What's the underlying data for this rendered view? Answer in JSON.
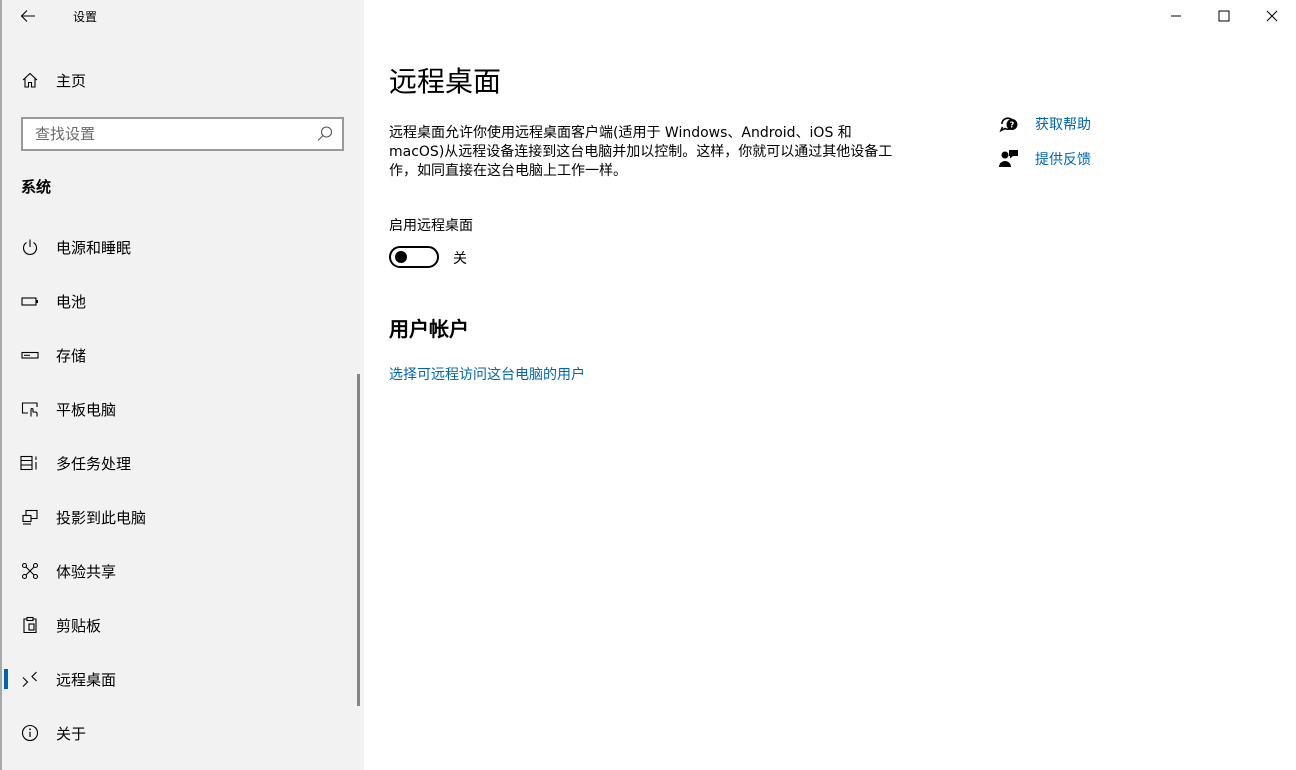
{
  "window": {
    "app_title": "设置",
    "controls": [
      "minimize-icon",
      "maximize-icon",
      "close-icon"
    ]
  },
  "sidebar": {
    "home_label": "主页",
    "search_placeholder": "查找设置",
    "section_title": "系统",
    "items": [
      {
        "label": "电源和睡眠",
        "icon": "power-icon"
      },
      {
        "label": "电池",
        "icon": "battery-icon"
      },
      {
        "label": "存储",
        "icon": "storage-icon"
      },
      {
        "label": "平板电脑",
        "icon": "tablet-icon"
      },
      {
        "label": "多任务处理",
        "icon": "multitasking-icon"
      },
      {
        "label": "投影到此电脑",
        "icon": "projecting-icon"
      },
      {
        "label": "体验共享",
        "icon": "shared-experiences-icon"
      },
      {
        "label": "剪贴板",
        "icon": "clipboard-icon"
      },
      {
        "label": "远程桌面",
        "icon": "remote-desktop-icon",
        "selected": true
      },
      {
        "label": "关于",
        "icon": "info-icon"
      }
    ]
  },
  "main": {
    "title": "远程桌面",
    "description": "远程桌面允许你使用远程桌面客户端(适用于 Windows、Android、iOS 和 macOS)从远程设备连接到这台电脑并加以控制。这样，你就可以通过其他设备工作，如同直接在这台电脑上工作一样。",
    "toggle_caption": "启用远程桌面",
    "toggle_state": "关",
    "toggle_on": false,
    "user_accounts_heading": "用户帐户",
    "user_accounts_link": "选择可远程访问这台电脑的用户"
  },
  "help": {
    "get_help": "获取帮助",
    "give_feedback": "提供反馈"
  },
  "colors": {
    "accent": "#0063b1",
    "link": "#0066b4",
    "sidebar_bg": "#f2f2f2"
  }
}
